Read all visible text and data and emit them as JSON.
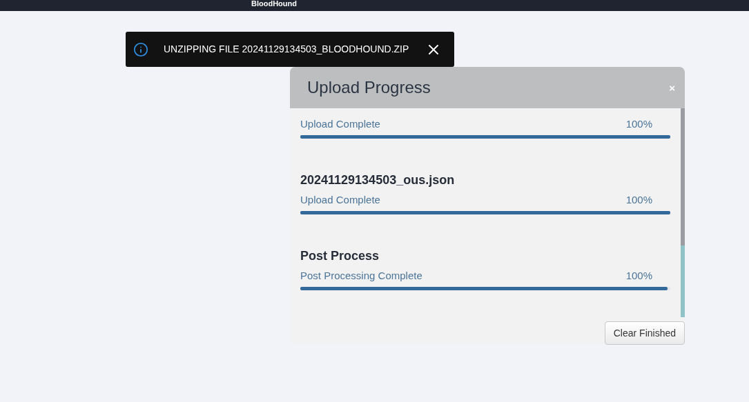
{
  "top_bar": {
    "title": "BloodHound"
  },
  "toast": {
    "message": "UNZIPPING FILE 20241129134503_BLOODHOUND.ZIP"
  },
  "dialog": {
    "title": "Upload Progress",
    "close": "×",
    "items": [
      {
        "status": "Upload Complete",
        "percent": "100%",
        "level": 1
      },
      {
        "name": "20241129134503_ous.json",
        "status": "Upload Complete",
        "percent": "100%",
        "level": 1
      },
      {
        "name": "Post Process",
        "status": "Post Processing Complete",
        "percent": "100%",
        "level": 0.993
      }
    ],
    "buttons": [
      "Clear Finished"
    ]
  }
}
